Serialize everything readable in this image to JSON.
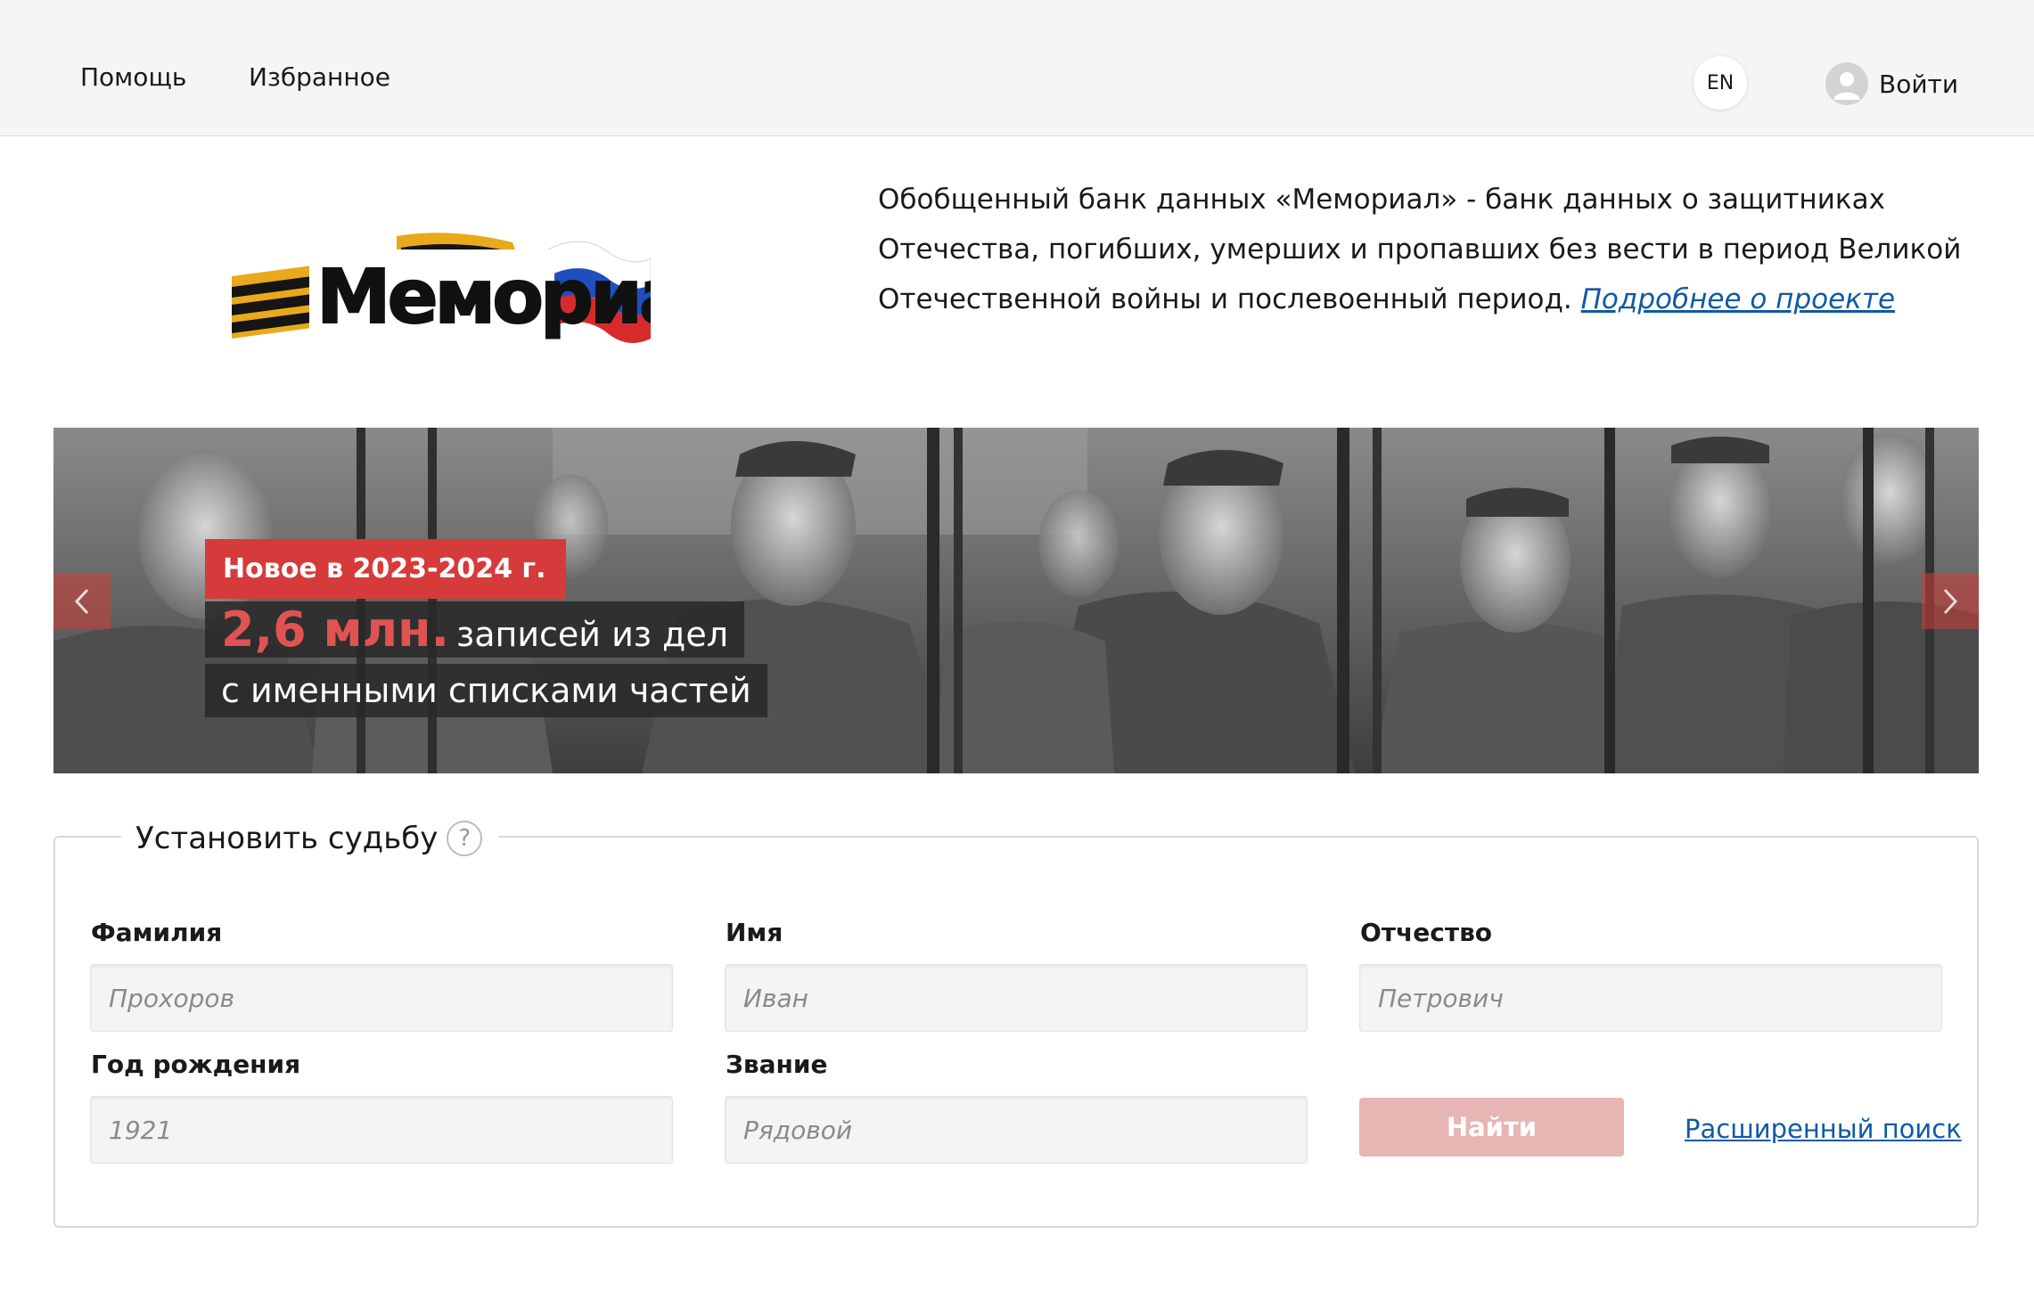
{
  "nav": {
    "help": "Помощь",
    "favorites": "Избранное",
    "lang": "EN",
    "login": "Войти"
  },
  "header": {
    "logo_text": "Мемориал",
    "intro_text": "Обобщенный банк данных «Мемориал» - банк данных о защитниках Отечества, погибших, умерших и пропавших без вести в период Великой Отечественной войны и послевоенный период.",
    "intro_link": "Подробнее о проекте"
  },
  "banner": {
    "badge": "Новое в 2023-2024 г.",
    "highlight": "2,6 млн.",
    "line1_rest": "записей из дел",
    "line2": "с именными списками частей"
  },
  "search": {
    "title": "Установить судьбу",
    "help_glyph": "?",
    "fields": {
      "surname": {
        "label": "Фамилия",
        "placeholder": "Прохоров"
      },
      "name": {
        "label": "Имя",
        "placeholder": "Иван"
      },
      "patronymic": {
        "label": "Отчество",
        "placeholder": "Петрович"
      },
      "birth_year": {
        "label": "Год рождения",
        "placeholder": "1921"
      },
      "rank": {
        "label": "Звание",
        "placeholder": "Рядовой"
      }
    },
    "submit": "Найти",
    "advanced": "Расширенный поиск"
  },
  "colors": {
    "accent_red": "#d63b3b",
    "button_disabled": "#e8b5b5",
    "link": "#0e5aa7"
  }
}
